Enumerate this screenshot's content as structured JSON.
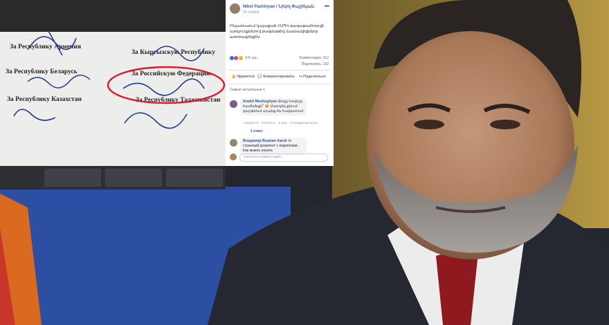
{
  "document": {
    "lines": [
      "За Республику Армения",
      "За Кыргызскую Республику",
      "За Республику Беларусь",
      "За Российскую Федерацию",
      "За Республику Казахстан",
      "За Республику Таджикистан"
    ]
  },
  "facebook": {
    "author": "Nikol Pashinyan / Նիկոլ Փաշինյան",
    "date": "20 ноября",
    "post_text": "Բելառուսում կայացած ՀԱՊԿ գագաթաժողովի արդյունքներով բազմաթիվ մասնակիցները ստորագրեցին։",
    "reactions_count": "4,6 тыс.",
    "comments_count": "Комментарии: 312",
    "shares_count": "Поделились: 192",
    "actions": [
      "Нравится",
      "Комментировать",
      "Поделиться"
    ],
    "sort_label": "Самые актуальные ▾",
    "comments": [
      {
        "name": "Anahit Mnshoghyan",
        "text": "Ջոզը հողերը համեմեցի՞ 😉 Մարդիկ քնում զարթնում սրանց են հավատում",
        "meta": "Нравится · Ответить · 1 нед. · Отредактировано",
        "replies": "1 ответ"
      },
      {
        "name": "Владимир Вешкин",
        "text": "Какой то странный документ с подписями . Как можно понять"
      }
    ],
    "write_placeholder": "Напишите комментарий..."
  },
  "colors": {
    "fb_link": "#385898",
    "highlight_circle": "#e0162b",
    "ink": "#1f3b8c"
  }
}
